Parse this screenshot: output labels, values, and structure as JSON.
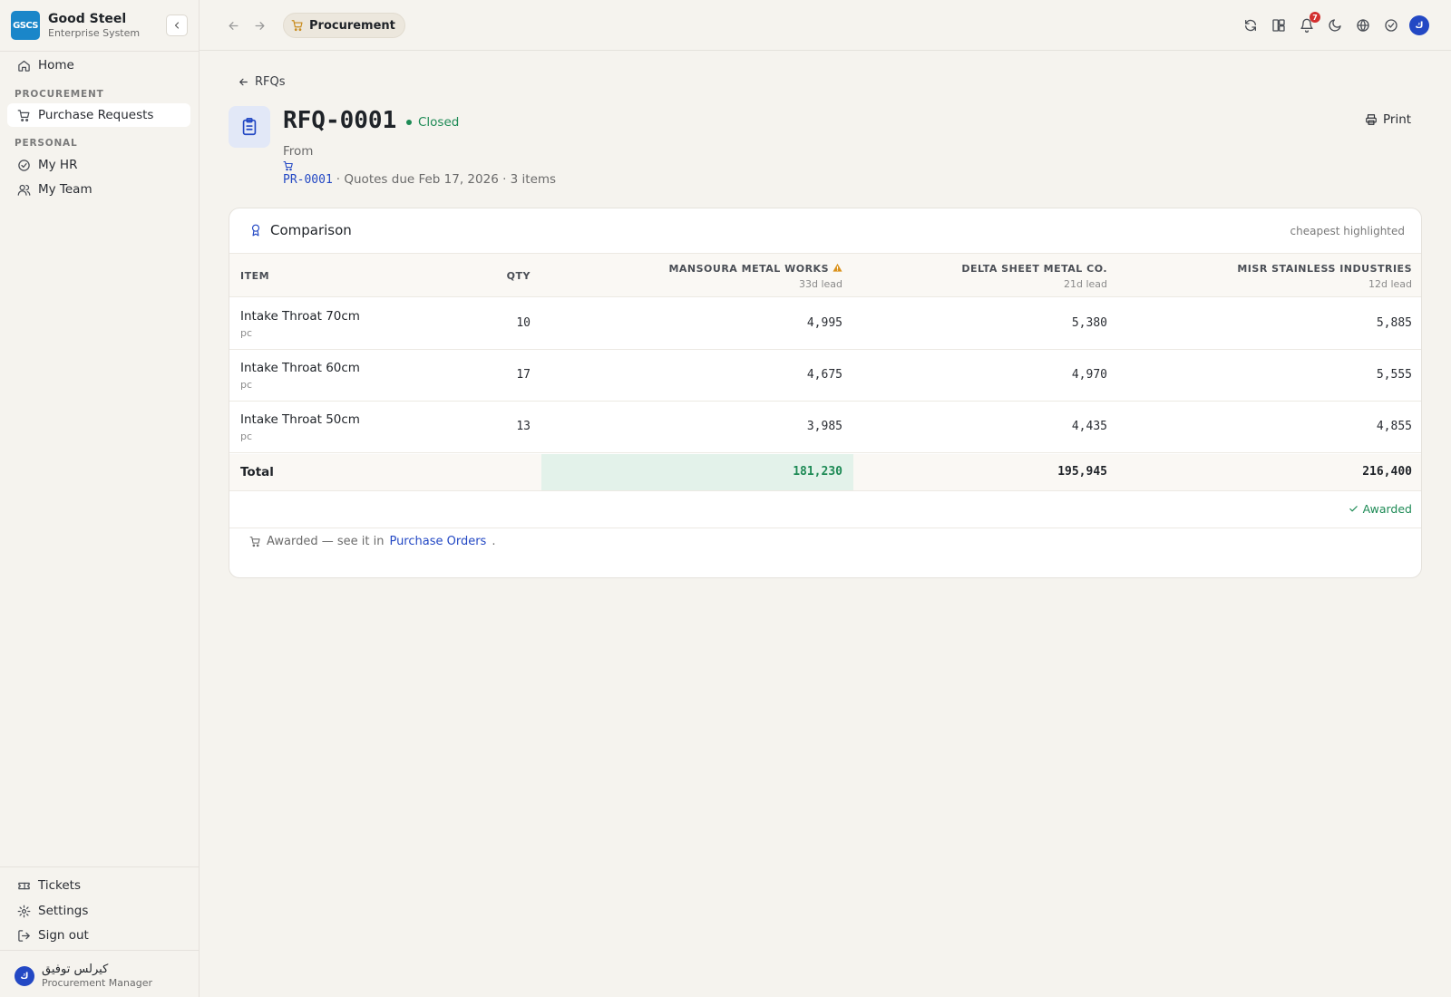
{
  "brand": {
    "logo": "GSCS",
    "name": "Good Steel",
    "subtitle": "Enterprise System"
  },
  "sidebar": {
    "home": "Home",
    "section_procurement": "PROCUREMENT",
    "purchase_requests": "Purchase Requests",
    "section_personal": "PERSONAL",
    "my_hr": "My HR",
    "my_team": "My Team",
    "tickets": "Tickets",
    "settings": "Settings",
    "sign_out": "Sign out"
  },
  "user": {
    "initial": "ك",
    "name": "كيرلس توفيق",
    "role": "Procurement Manager"
  },
  "topbar": {
    "module": "Procurement",
    "notification_count": "7",
    "avatar_initial": "ك"
  },
  "icons": {
    "back": "arrow-left-icon",
    "forward": "arrow-right-icon",
    "cart": "cart-icon",
    "refresh": "refresh-icon",
    "apps": "apps-icon",
    "bell": "bell-icon",
    "theme": "moon-icon",
    "language": "globe-icon",
    "tasks": "check-circle-icon",
    "print": "printer-icon",
    "clipboard": "clipboard-icon",
    "award": "award-icon",
    "warning": "warning-icon",
    "check": "check-icon"
  },
  "colors": {
    "accent": "#2348c4",
    "success": "#1d8a55",
    "warning": "#d9911a",
    "brand": "#1a86c9",
    "badge": "#d32f2f"
  },
  "rfq": {
    "back_label": "RFQs",
    "id": "RFQ-0001",
    "status": "Closed",
    "from_label": "From",
    "pr_ref": "PR-0001",
    "meta_text": "· Quotes due Feb 17, 2026 · 3 items",
    "print_label": "Print"
  },
  "comparison": {
    "title": "Comparison",
    "hint": "cheapest highlighted",
    "col_item": "ITEM",
    "col_qty": "QTY",
    "suppliers": [
      {
        "name": "MANSOURA METAL WORKS",
        "lead": "33d lead",
        "warning": true
      },
      {
        "name": "DELTA SHEET METAL CO.",
        "lead": "21d lead",
        "warning": false
      },
      {
        "name": "MISR STAINLESS INDUSTRIES",
        "lead": "12d lead",
        "warning": false
      }
    ],
    "rows": [
      {
        "item": "Intake Throat 70cm",
        "unit": "pc",
        "qty": "10",
        "prices": [
          "4,995",
          "5,380",
          "5,885"
        ]
      },
      {
        "item": "Intake Throat 60cm",
        "unit": "pc",
        "qty": "17",
        "prices": [
          "4,675",
          "4,970",
          "5,555"
        ]
      },
      {
        "item": "Intake Throat 50cm",
        "unit": "pc",
        "qty": "13",
        "prices": [
          "3,985",
          "4,435",
          "4,855"
        ]
      }
    ],
    "total_label": "Total",
    "totals": [
      "181,230",
      "195,945",
      "216,400"
    ],
    "awarded_label": "Awarded"
  },
  "footer_note": {
    "text": "Awarded — see it in",
    "link": "Purchase Orders",
    "suffix": "."
  }
}
